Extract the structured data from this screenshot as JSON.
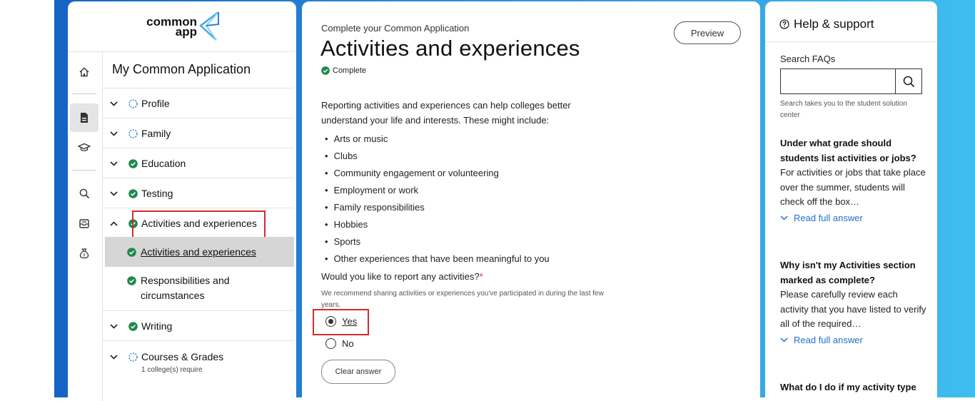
{
  "brand": {
    "logo_line1": "common",
    "logo_line2": "app"
  },
  "rail": {
    "icons": [
      "home-icon",
      "document-icon",
      "graduation-cap-icon",
      "search-icon",
      "inbox-icon",
      "money-bag-icon"
    ]
  },
  "nav": {
    "title": "My Common Application",
    "sections": [
      {
        "label": "Profile",
        "status": "in-progress"
      },
      {
        "label": "Family",
        "status": "in-progress"
      },
      {
        "label": "Education",
        "status": "complete"
      },
      {
        "label": "Testing",
        "status": "complete"
      },
      {
        "label": "Activities and experiences",
        "status": "complete",
        "expanded": true
      },
      {
        "label": "Writing",
        "status": "complete"
      },
      {
        "label": "Courses & Grades",
        "status": "in-progress",
        "note": "1 college(s) require"
      }
    ],
    "subitems": [
      {
        "label": "Activities and experiences",
        "status": "complete",
        "active": true
      },
      {
        "label": "Responsibilities and circumstances",
        "status": "complete"
      }
    ]
  },
  "main": {
    "eyebrow": "Complete your Common Application",
    "title": "Activities and experiences",
    "status": "Complete",
    "preview_label": "Preview",
    "intro": "Reporting activities and experiences can help colleges better understand your life and interests. These might include:",
    "bullets": [
      "Arts or music",
      "Clubs",
      "Community engagement or volunteering",
      "Employment or work",
      "Family responsibilities",
      "Hobbies",
      "Sports",
      "Other experiences that have been meaningful to you"
    ],
    "question": "Would you like to report any activities?",
    "required_mark": "*",
    "hint": "We recommend sharing activities or experiences you've participated in during the last few years.",
    "options": [
      {
        "label": "Yes",
        "selected": true
      },
      {
        "label": "No",
        "selected": false
      }
    ],
    "clear_label": "Clear answer"
  },
  "help": {
    "title": "Help & support",
    "search_label": "Search FAQs",
    "search_value": "",
    "search_hint": "Search takes you to the student solution center",
    "read_label": "Read full answer",
    "faqs": [
      {
        "q": "Under what grade should students list activities or jobs?",
        "a": "For activities or jobs that take place over the summer, students will check off the box…"
      },
      {
        "q": "Why isn't my Activities section marked as complete?",
        "a": "Please carefully review each activity that you have listed to verify all of the required…"
      },
      {
        "q": "What do I do if my activity type",
        "a": ""
      }
    ]
  },
  "colors": {
    "accent_blue": "#1f6fd0",
    "complete_green": "#1f8a4c",
    "highlight_red": "#d42a2a",
    "active_bg": "#d6d6d6"
  }
}
